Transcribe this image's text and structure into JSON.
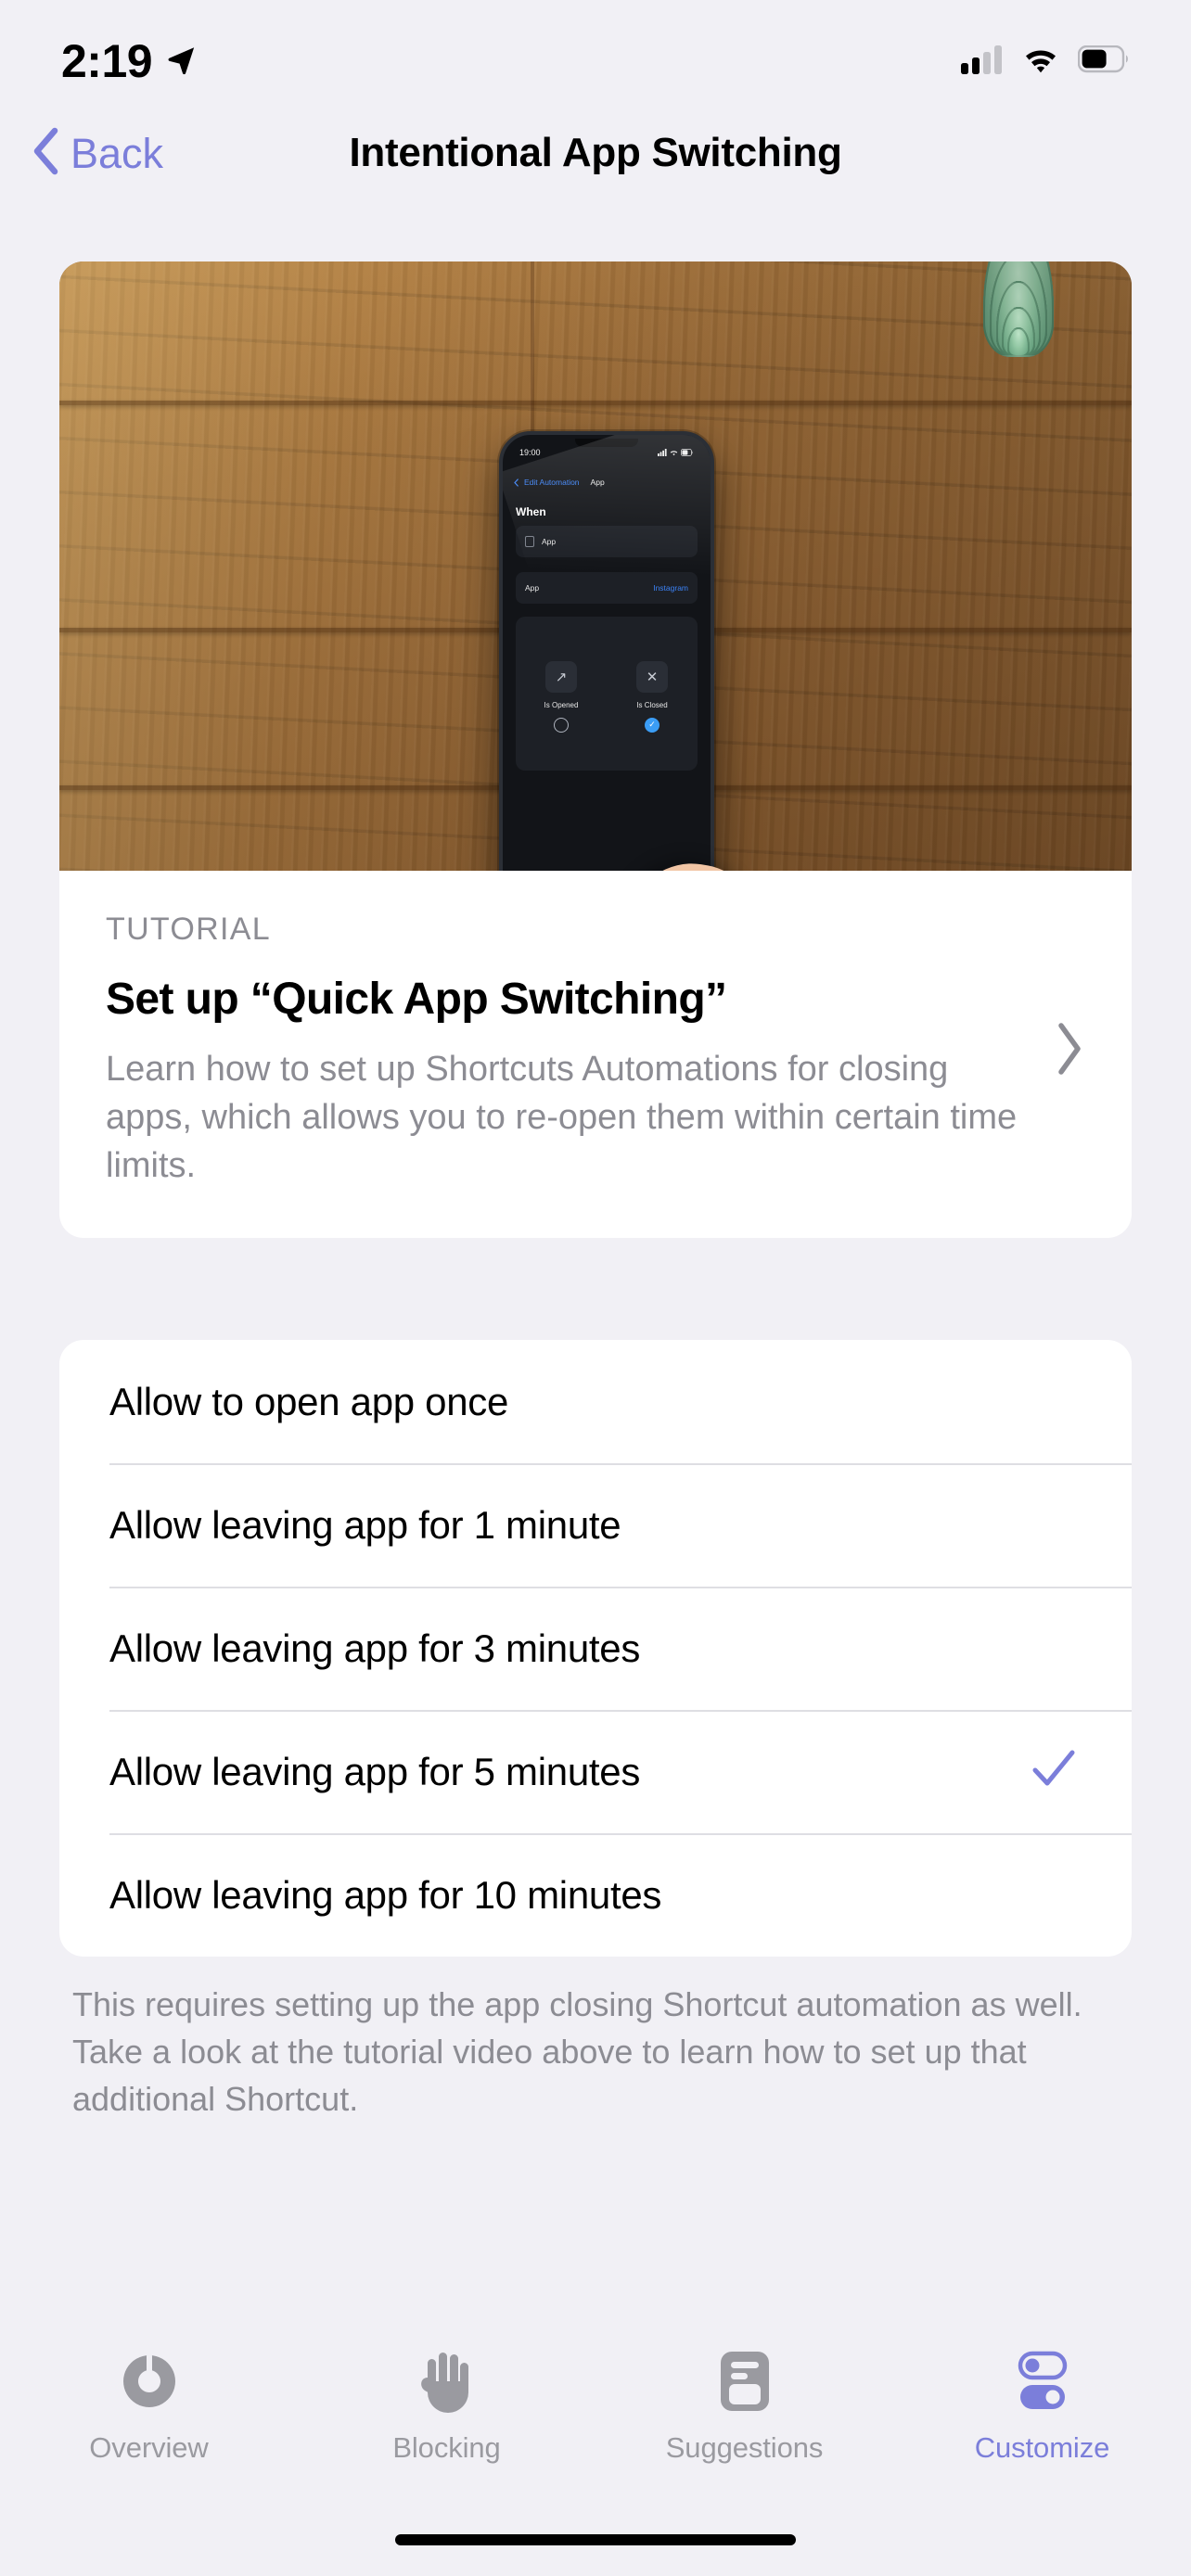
{
  "status_bar": {
    "time": "2:19",
    "location_icon": "location-arrow-icon",
    "cellular_icon": "cellular-signal-icon",
    "cellular_bars_filled": 2,
    "cellular_bars_total": 4,
    "wifi_icon": "wifi-icon",
    "battery_icon": "battery-icon",
    "battery_level_percent": 60
  },
  "nav": {
    "back_label": "Back",
    "back_icon": "chevron-left-icon",
    "title": "Intentional App Switching"
  },
  "tutorial_card": {
    "kicker": "TUTORIAL",
    "title": "Set up “Quick App Switching”",
    "description": "Learn how to set up Shortcuts Automations for closing apps, which allows you to re-open them within certain time limits.",
    "disclosure_icon": "chevron-right-icon",
    "hero": {
      "alt": "iPhone on a wooden table next to a succulent, showing the Shortcuts app Edit Automation screen with a finger tapping",
      "phone_screen": {
        "status_time": "19:00",
        "nav_back": "Edit Automation",
        "nav_title": "App",
        "section_heading": "When",
        "row_app": "App",
        "row_app_value_label": "App",
        "row_app_value": "Instagram",
        "option_opened_label": "Is Opened",
        "option_opened_icon": "arrow-up-right-icon",
        "option_opened_selected": false,
        "option_closed_label": "Is Closed",
        "option_closed_icon": "close-x-icon",
        "option_closed_selected": true
      }
    }
  },
  "options": {
    "items": [
      {
        "label": "Allow to open app once",
        "selected": false
      },
      {
        "label": "Allow leaving app for 1 minute",
        "selected": false
      },
      {
        "label": "Allow leaving app for 3 minutes",
        "selected": false
      },
      {
        "label": "Allow leaving app for 5 minutes",
        "selected": true
      },
      {
        "label": "Allow leaving app for 10 minutes",
        "selected": false
      }
    ],
    "check_icon": "checkmark-icon",
    "footer_note": "This requires setting up the app closing Shortcut automation as well. Take a look at the tutorial video above to learn how to set up that additional Shortcut."
  },
  "tab_bar": {
    "items": [
      {
        "label": "Overview",
        "icon": "gauge-ring-icon",
        "active": false
      },
      {
        "label": "Blocking",
        "icon": "hand-raised-icon",
        "active": false
      },
      {
        "label": "Suggestions",
        "icon": "card-list-icon",
        "active": false
      },
      {
        "label": "Customize",
        "icon": "toggles-icon",
        "active": true
      }
    ]
  },
  "colors": {
    "accent": "#7B7EDA",
    "background": "#F1F0F5",
    "card": "#FFFFFF",
    "secondary_text": "#8C8C93",
    "tab_inactive": "#9A9AA0",
    "divider": "#DEDEE3"
  }
}
